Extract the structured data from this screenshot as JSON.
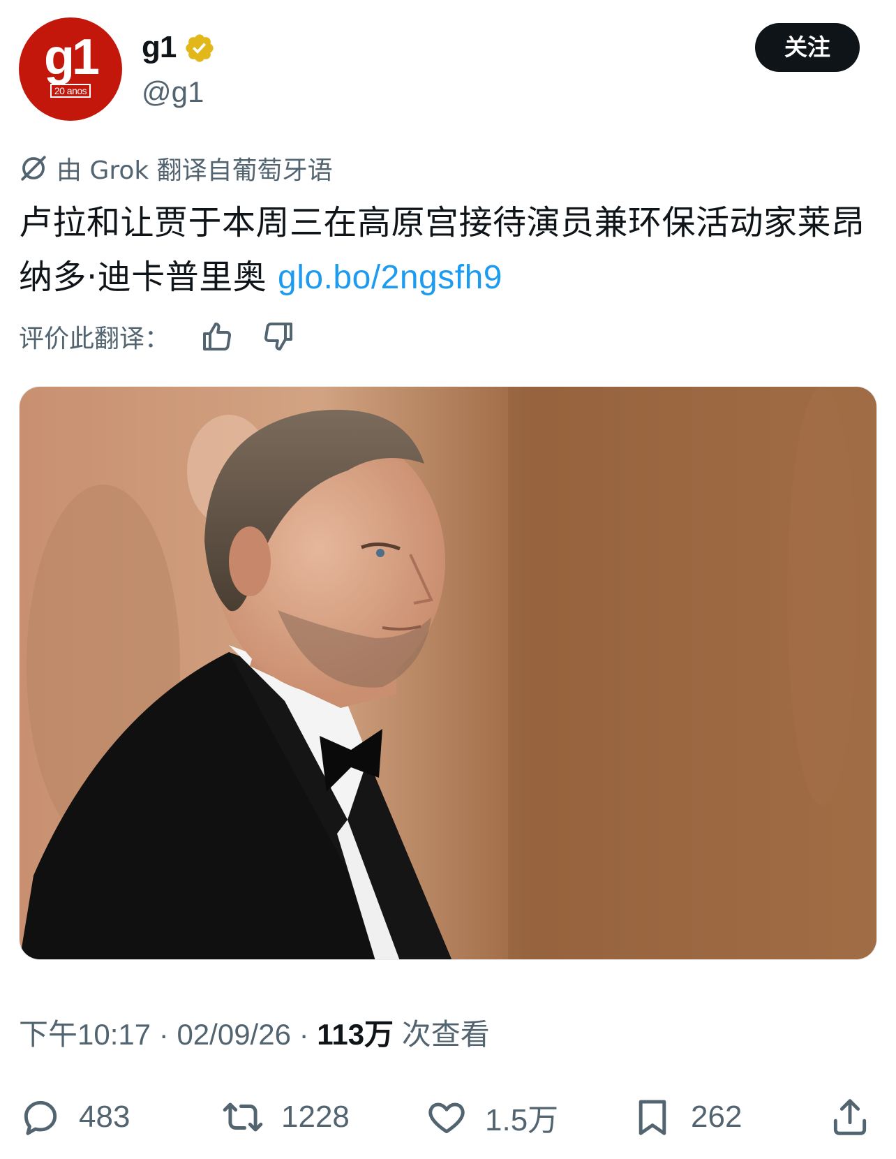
{
  "header": {
    "avatar_logo": "g1",
    "avatar_badge": "20 anos",
    "display_name": "g1",
    "handle": "@g1",
    "follow_label": "关注"
  },
  "translation": {
    "notice": "由 Grok 翻译自葡萄牙语",
    "rate_label": "评价此翻译："
  },
  "tweet": {
    "text": "卢拉和让贾于本周三在高原宫接待演员兼环保活动家莱昂纳多·迪卡普里奥 ",
    "link": "glo.bo/2ngsfh9"
  },
  "meta": {
    "time": "下午10:17",
    "separator": "·",
    "date": "02/09/26",
    "views_count": "113万",
    "views_label": "次查看"
  },
  "actions": {
    "reply_count": "483",
    "retweet_count": "1228",
    "like_count": "1.5万",
    "bookmark_count": "262"
  },
  "colors": {
    "avatar_bg": "#c4170c",
    "link": "#1d9bf0",
    "verified_gold": "#e2b719",
    "muted_text": "#536471"
  },
  "icons": [
    "verified-badge-icon",
    "grok-icon",
    "thumbs-up-icon",
    "thumbs-down-icon",
    "reply-icon",
    "retweet-icon",
    "like-icon",
    "bookmark-icon",
    "share-icon"
  ]
}
